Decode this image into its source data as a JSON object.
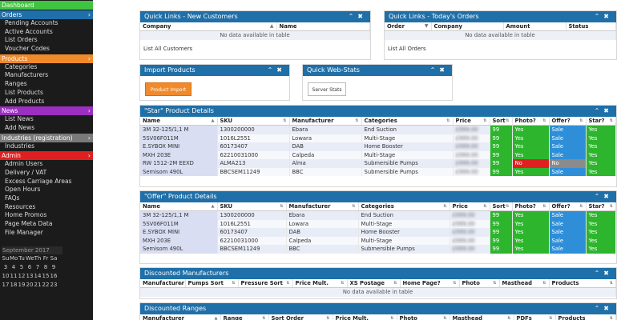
{
  "sidebar": {
    "sections": [
      {
        "title": "Dashboard",
        "color": "#3fc43f",
        "items": []
      },
      {
        "title": "Orders",
        "color": "#1f6fa8",
        "items": [
          "Pending Accounts",
          "Active Accounts",
          "List Orders",
          "Voucher Codes"
        ]
      },
      {
        "title": "Products",
        "color": "#f08a2a",
        "items": [
          "Categories",
          "Manufacturers",
          "Ranges",
          "List Products",
          "Add Products"
        ]
      },
      {
        "title": "News",
        "color": "#9b2fbf",
        "items": [
          "List News",
          "Add News"
        ]
      },
      {
        "title": "Industries (registration)",
        "color": "#7a7a7a",
        "items": [
          "Industries"
        ]
      },
      {
        "title": "Admin",
        "color": "#e02020",
        "items": [
          "Admin Users",
          "Delivery / VAT",
          "Excess Carriage Areas",
          "Open Hours",
          "FAQs",
          "Resources",
          "Home Promos",
          "Page Meta Data",
          "File Manager"
        ]
      }
    ],
    "calendar": {
      "month": "September 2017",
      "weekdays": [
        "Su",
        "Mo",
        "Tu",
        "We",
        "Th",
        "Fr",
        "Sa"
      ],
      "rows": [
        [
          "3",
          "4",
          "5",
          "6",
          "7",
          "8",
          "9"
        ],
        [
          "10",
          "11",
          "12",
          "13",
          "14",
          "15",
          "16"
        ],
        [
          "17",
          "18",
          "19",
          "20",
          "21",
          "22",
          "23"
        ]
      ]
    }
  },
  "panels": {
    "new_customers": {
      "title": "Quick Links - New Customers",
      "columns": [
        "Company",
        "Name"
      ],
      "empty": "No data available in table",
      "link": "List All Customers"
    },
    "todays_orders": {
      "title": "Quick Links - Today's Orders",
      "columns": [
        "Order",
        "Company",
        "Amount",
        "Status"
      ],
      "empty": "No data available in table",
      "link": "List All Orders"
    },
    "import_products": {
      "title": "Import Products",
      "button": "Product Import"
    },
    "web_stats": {
      "title": "Quick Web-Stats",
      "button": "Server Stats"
    },
    "star_products": {
      "title": "\"Star\" Product Details",
      "columns": [
        "Name",
        "SKU",
        "Manufacturer",
        "Categories",
        "Price",
        "Sort",
        "Photo?",
        "Offer?",
        "Star?"
      ],
      "rows": [
        [
          "3M 32-125/1,1 M",
          "1300200000",
          "Ebara",
          "End Suction",
          "£999.00",
          "99",
          "Yes",
          "Sale",
          "Yes"
        ],
        [
          "5SV06F011M",
          "1016L2551",
          "Lowara",
          "Multi-Stage",
          "£999.00",
          "99",
          "Yes",
          "Sale",
          "Yes"
        ],
        [
          "E.SYBOX MINI",
          "60173407",
          "DAB",
          "Home Booster",
          "£999.00",
          "99",
          "Yes",
          "Sale",
          "Yes"
        ],
        [
          "MXH 203E",
          "62210031000",
          "Calpeda",
          "Multi-Stage",
          "£999.00",
          "99",
          "Yes",
          "Sale",
          "Yes"
        ],
        [
          "RW 1512-2M EEXD",
          "ALMA213",
          "Alma",
          "Submersible Pumps",
          "£999.00",
          "99",
          "No",
          "No",
          "Yes"
        ],
        [
          "Semisom 490L",
          "BBCSEM11249",
          "BBC",
          "Submersible Pumps",
          "£999.00",
          "99",
          "Yes",
          "Sale",
          "Yes"
        ]
      ]
    },
    "offer_products": {
      "title": "\"Offer\" Product Details",
      "columns": [
        "Name",
        "SKU",
        "Manufacturer",
        "Categories",
        "Price",
        "Sort",
        "Photo?",
        "Offer?",
        "Star?"
      ],
      "rows": [
        [
          "3M 32-125/1,1 M",
          "1300200000",
          "Ebara",
          "End Suction",
          "£999.00",
          "99",
          "Yes",
          "Sale",
          "Yes"
        ],
        [
          "5SV06F011M",
          "1016L2551",
          "Lowara",
          "Multi-Stage",
          "£999.00",
          "99",
          "Yes",
          "Sale",
          "Yes"
        ],
        [
          "E.SYBOX MINI",
          "60173407",
          "DAB",
          "Home Booster",
          "£999.00",
          "99",
          "Yes",
          "Sale",
          "Yes"
        ],
        [
          "MXH 203E",
          "62210031000",
          "Calpeda",
          "Multi-Stage",
          "£999.00",
          "99",
          "Yes",
          "Sale",
          "Yes"
        ],
        [
          "Semisom 490L",
          "BBCSEM11249",
          "BBC",
          "Submersible Pumps",
          "£999.00",
          "99",
          "Yes",
          "Sale",
          "Yes"
        ]
      ]
    },
    "discounted_manufacturers": {
      "title": "Discounted Manufacturers",
      "columns": [
        "Manufacturer",
        "Pumps Sort",
        "Pressure Sort",
        "Price Mult.",
        "XS Postage",
        "Home Page?",
        "Photo",
        "Masthead",
        "Products"
      ],
      "empty": "No data available in table"
    },
    "discounted_ranges": {
      "title": "Discounted Ranges",
      "columns": [
        "Manufacturer",
        "Range",
        "Sort Order",
        "Price Mult.",
        "Photo",
        "Masthead",
        "PDFs",
        "Products"
      ]
    }
  }
}
